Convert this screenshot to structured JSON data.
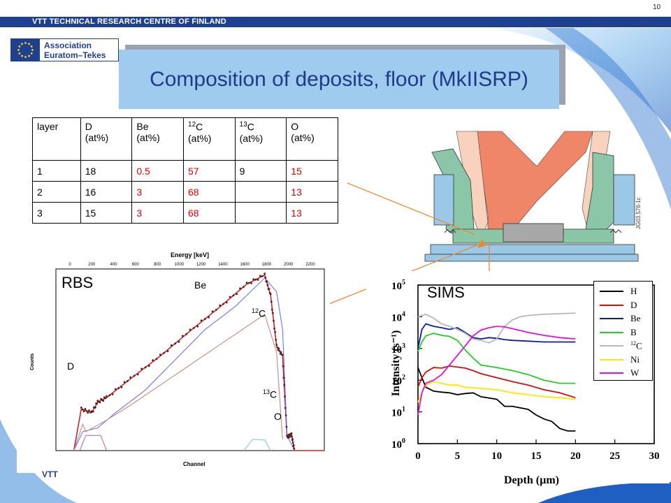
{
  "header": {
    "org": "VTT TECHNICAL RESEARCH CENTRE OF FINLAND",
    "slide_number": "10",
    "logo_line1": "Association",
    "logo_line2": "Euratom–Tekes",
    "footer_logo": "VTT"
  },
  "title": "Composition of deposits, floor (MkIISRP)",
  "table": {
    "headers": [
      {
        "pre": "",
        "main": "layer",
        "unit": ""
      },
      {
        "pre": "",
        "main": "D",
        "unit": "(at%)"
      },
      {
        "pre": "",
        "main": "Be",
        "unit": "(at%)"
      },
      {
        "pre": "12",
        "main": "C",
        "unit": "(at%)"
      },
      {
        "pre": "13",
        "main": "C",
        "unit": "(at%)"
      },
      {
        "pre": "",
        "main": "O",
        "unit": "(at%)"
      }
    ],
    "rows": [
      [
        "1",
        "18",
        "0.5",
        "57",
        "9",
        "15"
      ],
      [
        "2",
        "16",
        "3",
        "68",
        "",
        "13"
      ],
      [
        "3",
        "15",
        "3",
        "68",
        "",
        "13"
      ]
    ],
    "red_columns": [
      2,
      3,
      5
    ]
  },
  "figure_label": "JG03.576-1c",
  "chart_data": [
    {
      "type": "line",
      "title": "RBS",
      "xlabel": "Channel",
      "ylabel": "Counts",
      "top_axis_label": "Energy [keV]",
      "top_ticks": [
        "0",
        "200",
        "400",
        "600",
        "800",
        "1000",
        "1200",
        "1400",
        "1600",
        "1800",
        "2000",
        "2200"
      ],
      "xlim": [
        0,
        900
      ],
      "ylim": [
        0,
        2400
      ],
      "annotations": [
        {
          "text": "Be",
          "sup": ""
        },
        {
          "text": "C",
          "sup": "12"
        },
        {
          "text": "D",
          "sup": ""
        },
        {
          "text": "C",
          "sup": "13"
        },
        {
          "text": "O",
          "sup": ""
        }
      ],
      "series": [
        {
          "x": [
            60,
            85,
            120,
            140,
            170,
            250,
            350,
            450,
            550,
            640,
            700,
            720,
            740,
            760,
            775,
            790,
            800,
            900
          ],
          "y": [
            0,
            550,
            500,
            640,
            700,
            950,
            1250,
            1580,
            1900,
            2200,
            2320,
            2050,
            1380,
            1250,
            180,
            210,
            0,
            0
          ],
          "color": "#c0282c"
        },
        {
          "x": [
            60,
            90,
            140,
            200,
            300,
            400,
            500,
            600,
            700,
            740,
            760,
            775,
            800
          ],
          "y": [
            0,
            250,
            300,
            500,
            800,
            1200,
            1600,
            1900,
            2280,
            2100,
            1600,
            200,
            0
          ],
          "color": "#7070ff"
        },
        {
          "x": [
            60,
            90,
            100,
            160,
            250,
            400,
            550,
            700,
            740,
            760
          ],
          "y": [
            0,
            350,
            250,
            380,
            600,
            1000,
            1400,
            1800,
            1300,
            150
          ],
          "color": "#c48a7a"
        },
        {
          "x": [
            80,
            100,
            150,
            170
          ],
          "y": [
            0,
            200,
            200,
            0
          ],
          "color": "#b070b0"
        },
        {
          "x": [
            630,
            660,
            700,
            720
          ],
          "y": [
            0,
            150,
            140,
            0
          ],
          "color": "#80c8d8"
        }
      ]
    },
    {
      "type": "line",
      "title": "SIMS",
      "xlabel": "Depth (µm)",
      "ylabel": "Intensity (s⁻¹)",
      "log_y": true,
      "xlim": [
        0,
        30
      ],
      "ylim": [
        1,
        100000
      ],
      "x_ticks": [
        "0",
        "5",
        "10",
        "15",
        "20",
        "25",
        "30"
      ],
      "y_ticks": [
        {
          "base": "10",
          "exp": "0"
        },
        {
          "base": "10",
          "exp": "1"
        },
        {
          "base": "10",
          "exp": "2"
        },
        {
          "base": "10",
          "exp": "3"
        },
        {
          "base": "10",
          "exp": "4"
        },
        {
          "base": "10",
          "exp": "5"
        }
      ],
      "series": [
        {
          "name": "H",
          "sup": "",
          "color": "#000000",
          "x": [
            0,
            0.5,
            1,
            2,
            3,
            4,
            5,
            6,
            7,
            8,
            10,
            11,
            12,
            14,
            15,
            16,
            17,
            18,
            19,
            20
          ],
          "y": [
            250,
            120,
            60,
            45,
            42,
            40,
            35,
            38,
            40,
            30,
            25,
            15,
            15,
            12,
            8,
            6,
            5,
            3,
            2.5,
            2.5
          ]
        },
        {
          "name": "D",
          "sup": "",
          "color": "#d01010",
          "x": [
            0,
            0.5,
            1,
            2,
            3,
            4,
            5,
            6,
            7,
            8,
            10,
            12,
            14,
            16,
            18,
            20
          ],
          "y": [
            60,
            120,
            180,
            250,
            240,
            280,
            260,
            240,
            200,
            160,
            120,
            90,
            70,
            50,
            40,
            28
          ]
        },
        {
          "name": "Be",
          "sup": "",
          "color": "#0a1ea0",
          "x": [
            0,
            0.5,
            1,
            2,
            3,
            4,
            5,
            6,
            7,
            8,
            9,
            10,
            11,
            12,
            14,
            16,
            18,
            20
          ],
          "y": [
            1000,
            4000,
            6000,
            5000,
            4500,
            4000,
            4500,
            3200,
            2200,
            2000,
            2200,
            2100,
            1900,
            1800,
            1700,
            1600,
            1600,
            1600
          ]
        },
        {
          "name": "B",
          "sup": "",
          "color": "#20d020",
          "x": [
            0,
            0.5,
            1,
            2,
            3,
            4,
            5,
            6,
            7,
            8,
            10,
            12,
            14,
            16,
            18,
            20
          ],
          "y": [
            800,
            1600,
            2500,
            3000,
            2600,
            2400,
            1800,
            900,
            500,
            300,
            250,
            200,
            150,
            100,
            80,
            80
          ]
        },
        {
          "name": "C",
          "sup": "12",
          "color": "#b8b8b8",
          "x": [
            0,
            1,
            2,
            3,
            4,
            5,
            6,
            7,
            8,
            9,
            10,
            11,
            12,
            13,
            14,
            16,
            18,
            20
          ],
          "y": [
            10000,
            12000,
            9000,
            6000,
            5000,
            4000,
            3000,
            2000,
            1800,
            1500,
            2000,
            5000,
            8000,
            10000,
            11000,
            12000,
            12500,
            13000
          ]
        },
        {
          "name": "Ni",
          "sup": "",
          "color": "#ffe600",
          "x": [
            0,
            0.5,
            1,
            2,
            3,
            4,
            5,
            6,
            8,
            10,
            12,
            14,
            16,
            18,
            20
          ],
          "y": [
            20,
            40,
            70,
            90,
            80,
            70,
            70,
            60,
            55,
            50,
            40,
            35,
            30,
            28,
            25
          ]
        },
        {
          "name": "W",
          "sup": "",
          "color": "#e010e0",
          "x": [
            0,
            0.5,
            1,
            2,
            3,
            4,
            5,
            6,
            7,
            8,
            9,
            10,
            11,
            12,
            14,
            16,
            18,
            20
          ],
          "y": [
            8,
            40,
            80,
            100,
            150,
            300,
            600,
            1200,
            2500,
            3800,
            4500,
            5000,
            4800,
            4200,
            3200,
            2600,
            2200,
            2000
          ]
        }
      ]
    }
  ]
}
